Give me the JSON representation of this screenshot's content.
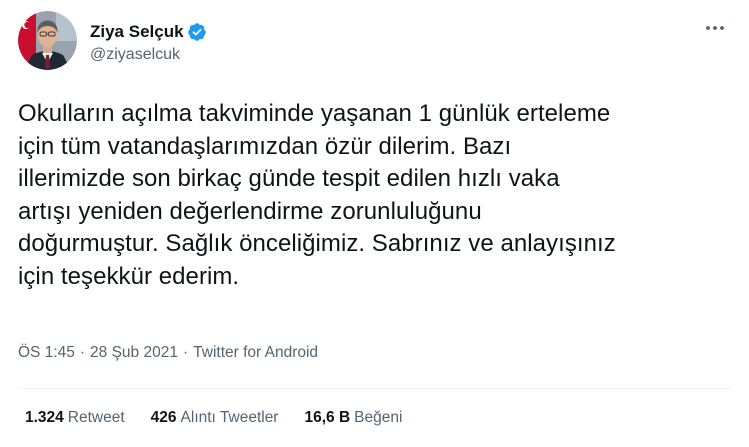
{
  "user": {
    "display_name": "Ziya Selçuk",
    "handle": "@ziyaselcuk",
    "verified_icon": "verified-badge-icon",
    "avatar_icon": "profile-photo"
  },
  "menu": {
    "icon": "more-options-icon"
  },
  "tweet": {
    "text": "Okulların açılma takviminde yaşanan 1 günlük erteleme\niçin tüm vatandaşlarımızdan özür dilerim. Bazı\nillerimizde son birkaç günde tespit edilen hızlı vaka\nartışı yeniden değerlendirme zorunluluğunu\ndoğurmuştur. Sağlık önceliğimiz. Sabrınız ve anlayışınız\niçin teşekkür ederim."
  },
  "meta": {
    "time": "ÖS 1:45",
    "separator": "·",
    "date": "28 Şub 2021",
    "source": "Twitter for Android"
  },
  "stats": [
    {
      "count": "1.324",
      "label": "Retweet"
    },
    {
      "count": "426",
      "label": "Alıntı Tweetler"
    },
    {
      "count": "16,6 B",
      "label": "Beğeni"
    }
  ],
  "colors": {
    "text": "#0f1419",
    "secondary": "#536471",
    "verified": "#1d9bf0",
    "divider": "#eff3f4"
  }
}
